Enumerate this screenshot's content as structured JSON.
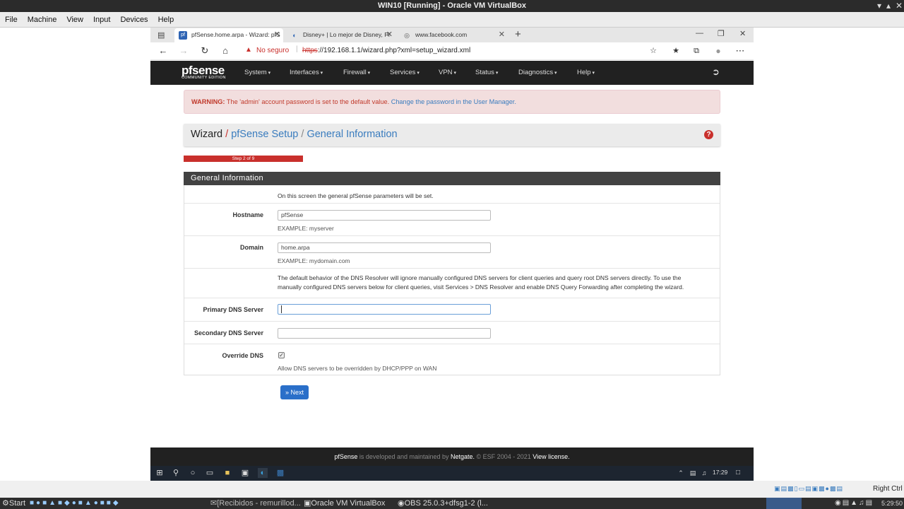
{
  "vbox": {
    "title": "WIN10 [Running] - Oracle VM VirtualBox",
    "menu": [
      "File",
      "Machine",
      "View",
      "Input",
      "Devices",
      "Help"
    ],
    "host_key": "Right Ctrl"
  },
  "browser": {
    "tabs": [
      {
        "label": "pfSense.home.arpa - Wizard: pfS"
      },
      {
        "label": "Disney+ | Lo mejor de Disney, Pi"
      },
      {
        "label": "www.facebook.com"
      }
    ],
    "security": "No seguro",
    "url_scheme": "https",
    "url_rest": "://192.168.1.1/wizard.php?xml=setup_wizard.xml"
  },
  "pf": {
    "logo": "pfsense",
    "logo_sub": "COMMUNITY EDITION",
    "menu": [
      "System",
      "Interfaces",
      "Firewall",
      "Services",
      "VPN",
      "Status",
      "Diagnostics",
      "Help"
    ],
    "warning_label": "WARNING:",
    "warning_text": "The 'admin' account password is set to the default value.",
    "warning_link": "Change the password in the User Manager.",
    "crumb": {
      "root": "Wizard",
      "sep": "/",
      "setup": "pfSense Setup",
      "page": "General Information"
    },
    "progress": {
      "label": "Step 2 of 9",
      "fraction": 0.222
    },
    "panel_title": "General Information",
    "intro": "On this screen the general pfSense parameters will be set.",
    "hostname": {
      "label": "Hostname",
      "value": "pfSense",
      "hint": "EXAMPLE: myserver"
    },
    "domain": {
      "label": "Domain",
      "value": "home.arpa",
      "hint": "EXAMPLE: mydomain.com"
    },
    "dns_note1": "The default behavior of the DNS Resolver will ignore manually configured DNS servers for client queries and query root DNS servers directly. To use the",
    "dns_note2": "manually configured DNS servers below for client queries, visit Services > DNS Resolver and enable DNS Query Forwarding after completing the wizard.",
    "primary": {
      "label": "Primary DNS Server",
      "value": ""
    },
    "secondary": {
      "label": "Secondary DNS Server",
      "value": ""
    },
    "override": {
      "label": "Override DNS",
      "checked": true,
      "hint": "Allow DNS servers to be overridden by DHCP/PPP on WAN"
    },
    "next": "Next",
    "footer": {
      "brand": "pfSense",
      "mid": " is developed and maintained by ",
      "company": "Netgate.",
      "copy": " © ESF 2004 - 2021 ",
      "license": "View license."
    }
  },
  "win": {
    "time": "17:29"
  },
  "host": {
    "start": "Start",
    "tasks": [
      "[Recibidos - remurillod...",
      "Oracle VM VirtualBox",
      "OBS 25.0.3+dfsg1-2 (l..."
    ],
    "time": "5:29:50"
  }
}
